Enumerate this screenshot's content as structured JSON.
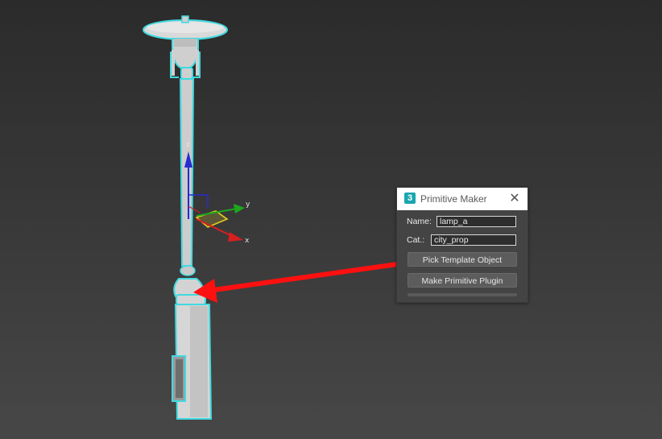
{
  "viewport": {
    "gizmo_labels": {
      "z": "z",
      "y": "y",
      "x": "x"
    },
    "colors": {
      "selection": "#41d9e0",
      "axis_x": "#d42020",
      "axis_y": "#1fa51f",
      "axis_z": "#2a2ad0",
      "arrow": "#ff1010"
    }
  },
  "dialog": {
    "title": "Primitive Maker",
    "icon_text": "3",
    "name_label": "Name:",
    "name_value": "lamp_a",
    "cat_label": "Cat.:",
    "cat_value": "city_prop",
    "pick_button": "Pick Template Object",
    "make_button": "Make Primitive Plugin",
    "progress": 0
  }
}
